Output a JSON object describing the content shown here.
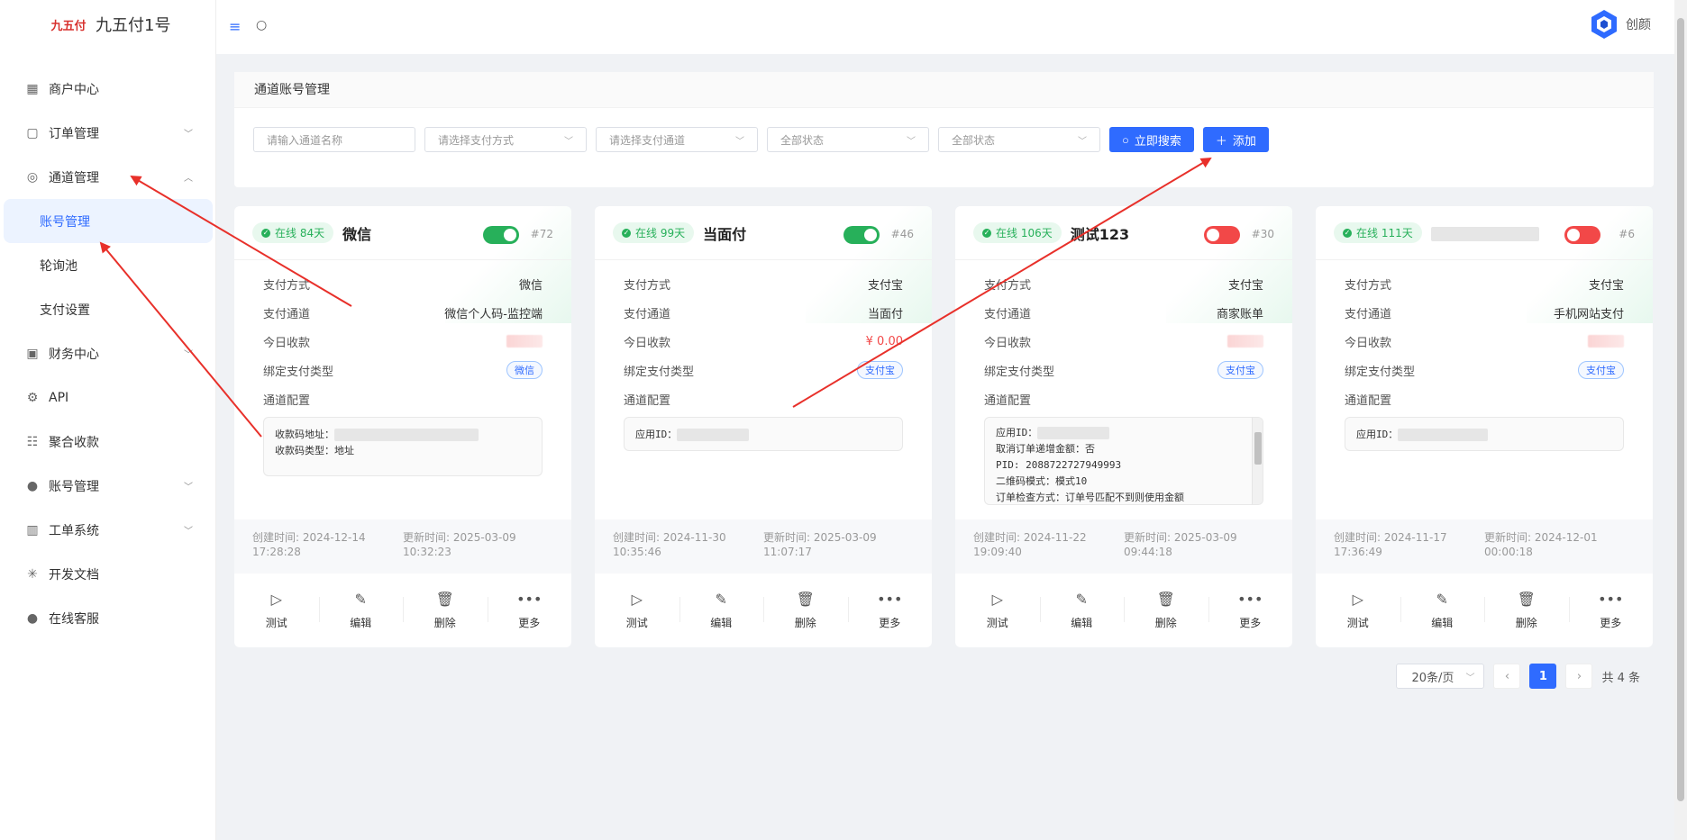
{
  "brand": {
    "logo_text": "九五付",
    "name": "九五付1号"
  },
  "user": {
    "name": "创颜"
  },
  "nav": {
    "items": [
      {
        "label": "商户中心",
        "icon": "grid-icon"
      },
      {
        "label": "订单管理",
        "icon": "bag-icon"
      },
      {
        "label": "通道管理",
        "icon": "channel-icon"
      }
    ],
    "sub": [
      {
        "label": "账号管理",
        "active": true
      },
      {
        "label": "轮询池"
      },
      {
        "label": "支付设置"
      }
    ],
    "items2": [
      {
        "label": "财务中心",
        "icon": "finance-icon"
      },
      {
        "label": "API",
        "icon": "api-icon"
      },
      {
        "label": "聚合收款",
        "icon": "aggregate-icon"
      },
      {
        "label": "账号管理",
        "icon": "user-icon"
      },
      {
        "label": "工单系统",
        "icon": "book-icon"
      },
      {
        "label": "开发文档",
        "icon": "loading-icon"
      },
      {
        "label": "在线客服",
        "icon": "support-icon"
      }
    ]
  },
  "panel": {
    "title": "通道账号管理",
    "name_placeholder": "请输入通道名称",
    "pay_method": "请选择支付方式",
    "pay_channel": "请选择支付通道",
    "status1": "全部状态",
    "status2": "全部状态",
    "search_label": "立即搜索",
    "add_label": "添加"
  },
  "labels": {
    "pay_method": "支付方式",
    "pay_channel": "支付通道",
    "today_income": "今日收款",
    "bind_type": "绑定支付类型",
    "config": "通道配置",
    "test": "测试",
    "edit": "编辑",
    "delete": "删除",
    "more": "更多"
  },
  "cards": [
    {
      "online": "在线 84天",
      "name": "微信",
      "id": "#72",
      "enabled": true,
      "pay_method": "微信",
      "pay_channel": "微信个人码-监控端",
      "bind_tag": "微信",
      "config_line1": "收款码地址：",
      "config_line2": "收款码类型：地址",
      "created": "创建时间: 2024-12-14 17:28:28",
      "updated": "更新时间: 2025-03-09 10:32:23"
    },
    {
      "online": "在线 99天",
      "name": "当面付",
      "id": "#46",
      "enabled": true,
      "pay_method": "支付宝",
      "pay_channel": "当面付",
      "today_income": "¥ 0.00",
      "bind_tag": "支付宝",
      "config_line1": "应用ID：",
      "created": "创建时间: 2024-11-30 10:35:46",
      "updated": "更新时间: 2025-03-09 11:07:17"
    },
    {
      "online": "在线 106天",
      "name": "测试123",
      "id": "#30",
      "enabled": false,
      "pay_method": "支付宝",
      "pay_channel": "商家账单",
      "bind_tag": "支付宝",
      "config_line1": "应用ID：",
      "config_line2": "取消订单递增金额：否",
      "config_line3": "PID: 2088722727949993",
      "config_line4": "二维码模式：模式10",
      "config_line5": "订单检查方式：订单号匹配不到则使用金额",
      "created": "创建时间: 2024-11-22 19:09:40",
      "updated": "更新时间: 2025-03-09 09:44:18"
    },
    {
      "online": "在线 111天",
      "name": "",
      "id": "#6",
      "enabled": false,
      "pay_method": "支付宝",
      "pay_channel": "手机网站支付",
      "bind_tag": "支付宝",
      "config_line1": "应用ID：",
      "created": "创建时间: 2024-11-17 17:36:49",
      "updated": "更新时间: 2024-12-01 00:00:18"
    }
  ],
  "pager": {
    "size": "20条/页",
    "current": "1",
    "total": "共 4 条"
  },
  "colors": {
    "primary": "#2f6bff",
    "online": "#27b05a",
    "off": "#f24848"
  }
}
